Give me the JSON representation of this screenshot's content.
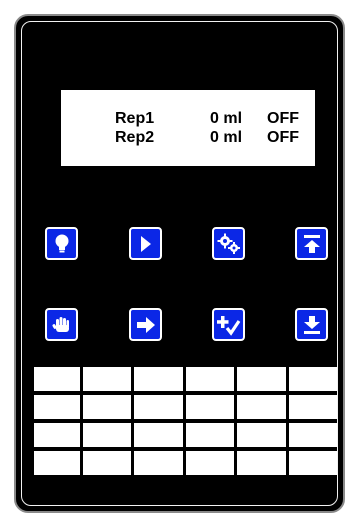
{
  "display": {
    "rows": [
      {
        "name": "Rep1",
        "volume": "0 ml",
        "state": "OFF"
      },
      {
        "name": "Rep2",
        "volume": "0 ml",
        "state": "OFF"
      }
    ]
  },
  "keys_row1": [
    {
      "icon": "lightbulb-icon"
    },
    {
      "icon": "play-icon"
    },
    {
      "icon": "gears-icon"
    },
    {
      "icon": "arrow-up-to-top-icon"
    }
  ],
  "keys_row2": [
    {
      "icon": "hand-stop-icon"
    },
    {
      "icon": "arrow-right-icon"
    },
    {
      "icon": "plus-check-icon"
    },
    {
      "icon": "arrow-down-to-bottom-icon"
    }
  ],
  "keypad": {
    "rows": 4,
    "columns": 6
  },
  "colors": {
    "device": "#000000",
    "button": "#0b27e6",
    "display": "#ffffff"
  }
}
